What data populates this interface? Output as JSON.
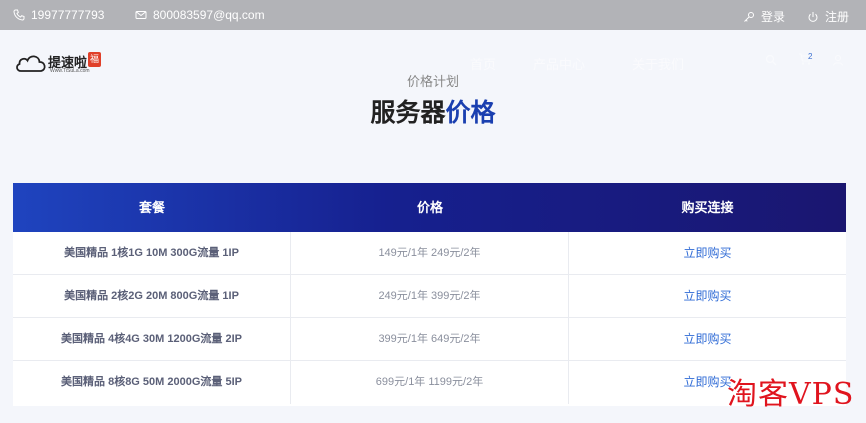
{
  "topbar": {
    "phone": "19977777793",
    "email": "800083597@qq.com",
    "login": "登录",
    "register": "注册"
  },
  "header": {
    "logo_name": "提速啦",
    "logo_badge": "福",
    "logo_url": "Www.TiSuLa.com",
    "nav": [
      "首页",
      "产品中心",
      "关于我们"
    ],
    "cart_count": "2"
  },
  "section": {
    "subtitle": "价格计划",
    "title_main": "服务器",
    "title_accent": "价格"
  },
  "pricing_table": {
    "columns": [
      "套餐",
      "价格",
      "购买连接"
    ],
    "rows": [
      {
        "plan": "美国精品 1核1G 10M 300G流量 1IP",
        "price": "149元/1年 249元/2年",
        "link": "立即购买"
      },
      {
        "plan": "美国精品 2核2G 20M 800G流量 1IP",
        "price": "249元/1年 399元/2年",
        "link": "立即购买"
      },
      {
        "plan": "美国精品 4核4G 30M 1200G流量 2IP",
        "price": "399元/1年 649元/2年",
        "link": "立即购买"
      },
      {
        "plan": "美国精品 8核8G 50M 2000G流量 5IP",
        "price": "699元/1年 1199元/2年",
        "link": "立即购买"
      }
    ]
  },
  "watermark": "淘客VPS",
  "colors": {
    "accent": "#1a3fb0",
    "link": "#2f6bd6",
    "watermark": "#e0141e"
  }
}
